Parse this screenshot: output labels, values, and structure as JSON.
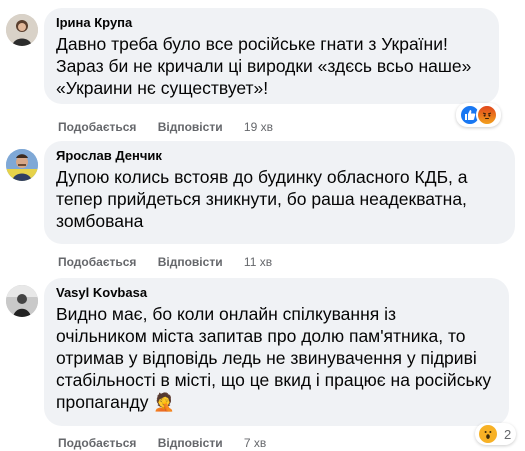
{
  "comments": [
    {
      "author": "Ірина Крупа",
      "lines": [
        "Давно треба було все російське гнати з України!",
        "Зараз би не кричали ці виродки «здєсь всьо наше»",
        "«Украини нє существует»!"
      ],
      "like_label": "Подобається",
      "reply_label": "Відповісти",
      "time": "19 хв",
      "reactions": [
        "like-icon",
        "angry-icon"
      ]
    },
    {
      "author": "Ярослав Денчик",
      "lines": [
        "Дупою колись встояв до будинку обласного КДБ, а",
        "тепер прийдеться зникнути, бо раша неадекватна,",
        "зомбована"
      ],
      "like_label": "Подобається",
      "reply_label": "Відповісти",
      "time": "11 хв"
    },
    {
      "author": "Vasyl Kovbasa",
      "lines": [
        "Видно має, бо коли онлайн спілкування із",
        "очільником міста запитав про долю пам'ятника, то",
        "отримав у відповідь ледь не звинувачення у підриві",
        "стабільності в місті, що це вкид і працює на російську",
        "пропаганду"
      ],
      "emoji": "🤦",
      "like_label": "Подобається",
      "reply_label": "Відповісти",
      "time": "7 хв",
      "reaction_count": "2",
      "reactions": [
        "wow-icon"
      ]
    }
  ],
  "colors": {
    "bubble": "#f0f2f5",
    "meta": "#65676b",
    "like_blue": "#1877f2",
    "angry_orange": "#e9710f",
    "wow_yellow": "#f7b125"
  }
}
